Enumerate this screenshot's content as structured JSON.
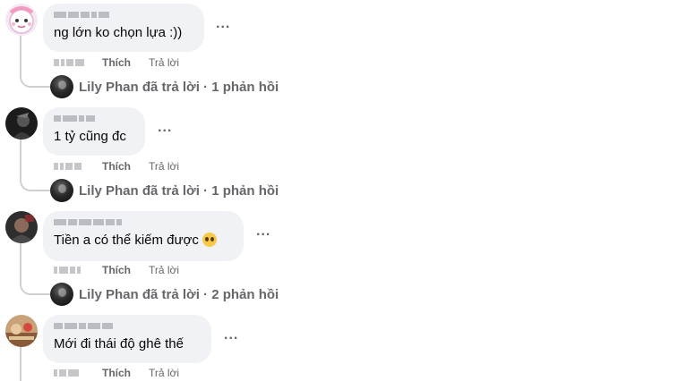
{
  "comments": [
    {
      "author": "blurred-name-1",
      "text": "ng lớn ko chọn lựa :))",
      "actions": {
        "like": "Thích",
        "reply": "Trả lời"
      },
      "reply_summary": "Lily Phan đã trả lời · 1 phản hồi"
    },
    {
      "author": "blurred-name-2",
      "text": "1 tỷ cũng đc",
      "actions": {
        "like": "Thích",
        "reply": "Trả lời"
      },
      "reply_summary": "Lily Phan đã trả lời · 1 phản hồi"
    },
    {
      "author": "blurred-name-3",
      "text": "Tiền a có thể kiếm được",
      "emoji": "pleading-face",
      "actions": {
        "like": "Thích",
        "reply": "Trả lời"
      },
      "reply_summary": "Lily Phan đã trả lời · 2 phản hồi"
    },
    {
      "author": "blurred-name-4",
      "text": "Mới đi thái độ ghê thế",
      "actions": {
        "like": "Thích",
        "reply": "Trả lời"
      }
    }
  ],
  "more_label": "...",
  "colors": {
    "bubble": "#f0f2f5",
    "muted_text": "#65676b",
    "thread_line": "#ced0d4"
  }
}
